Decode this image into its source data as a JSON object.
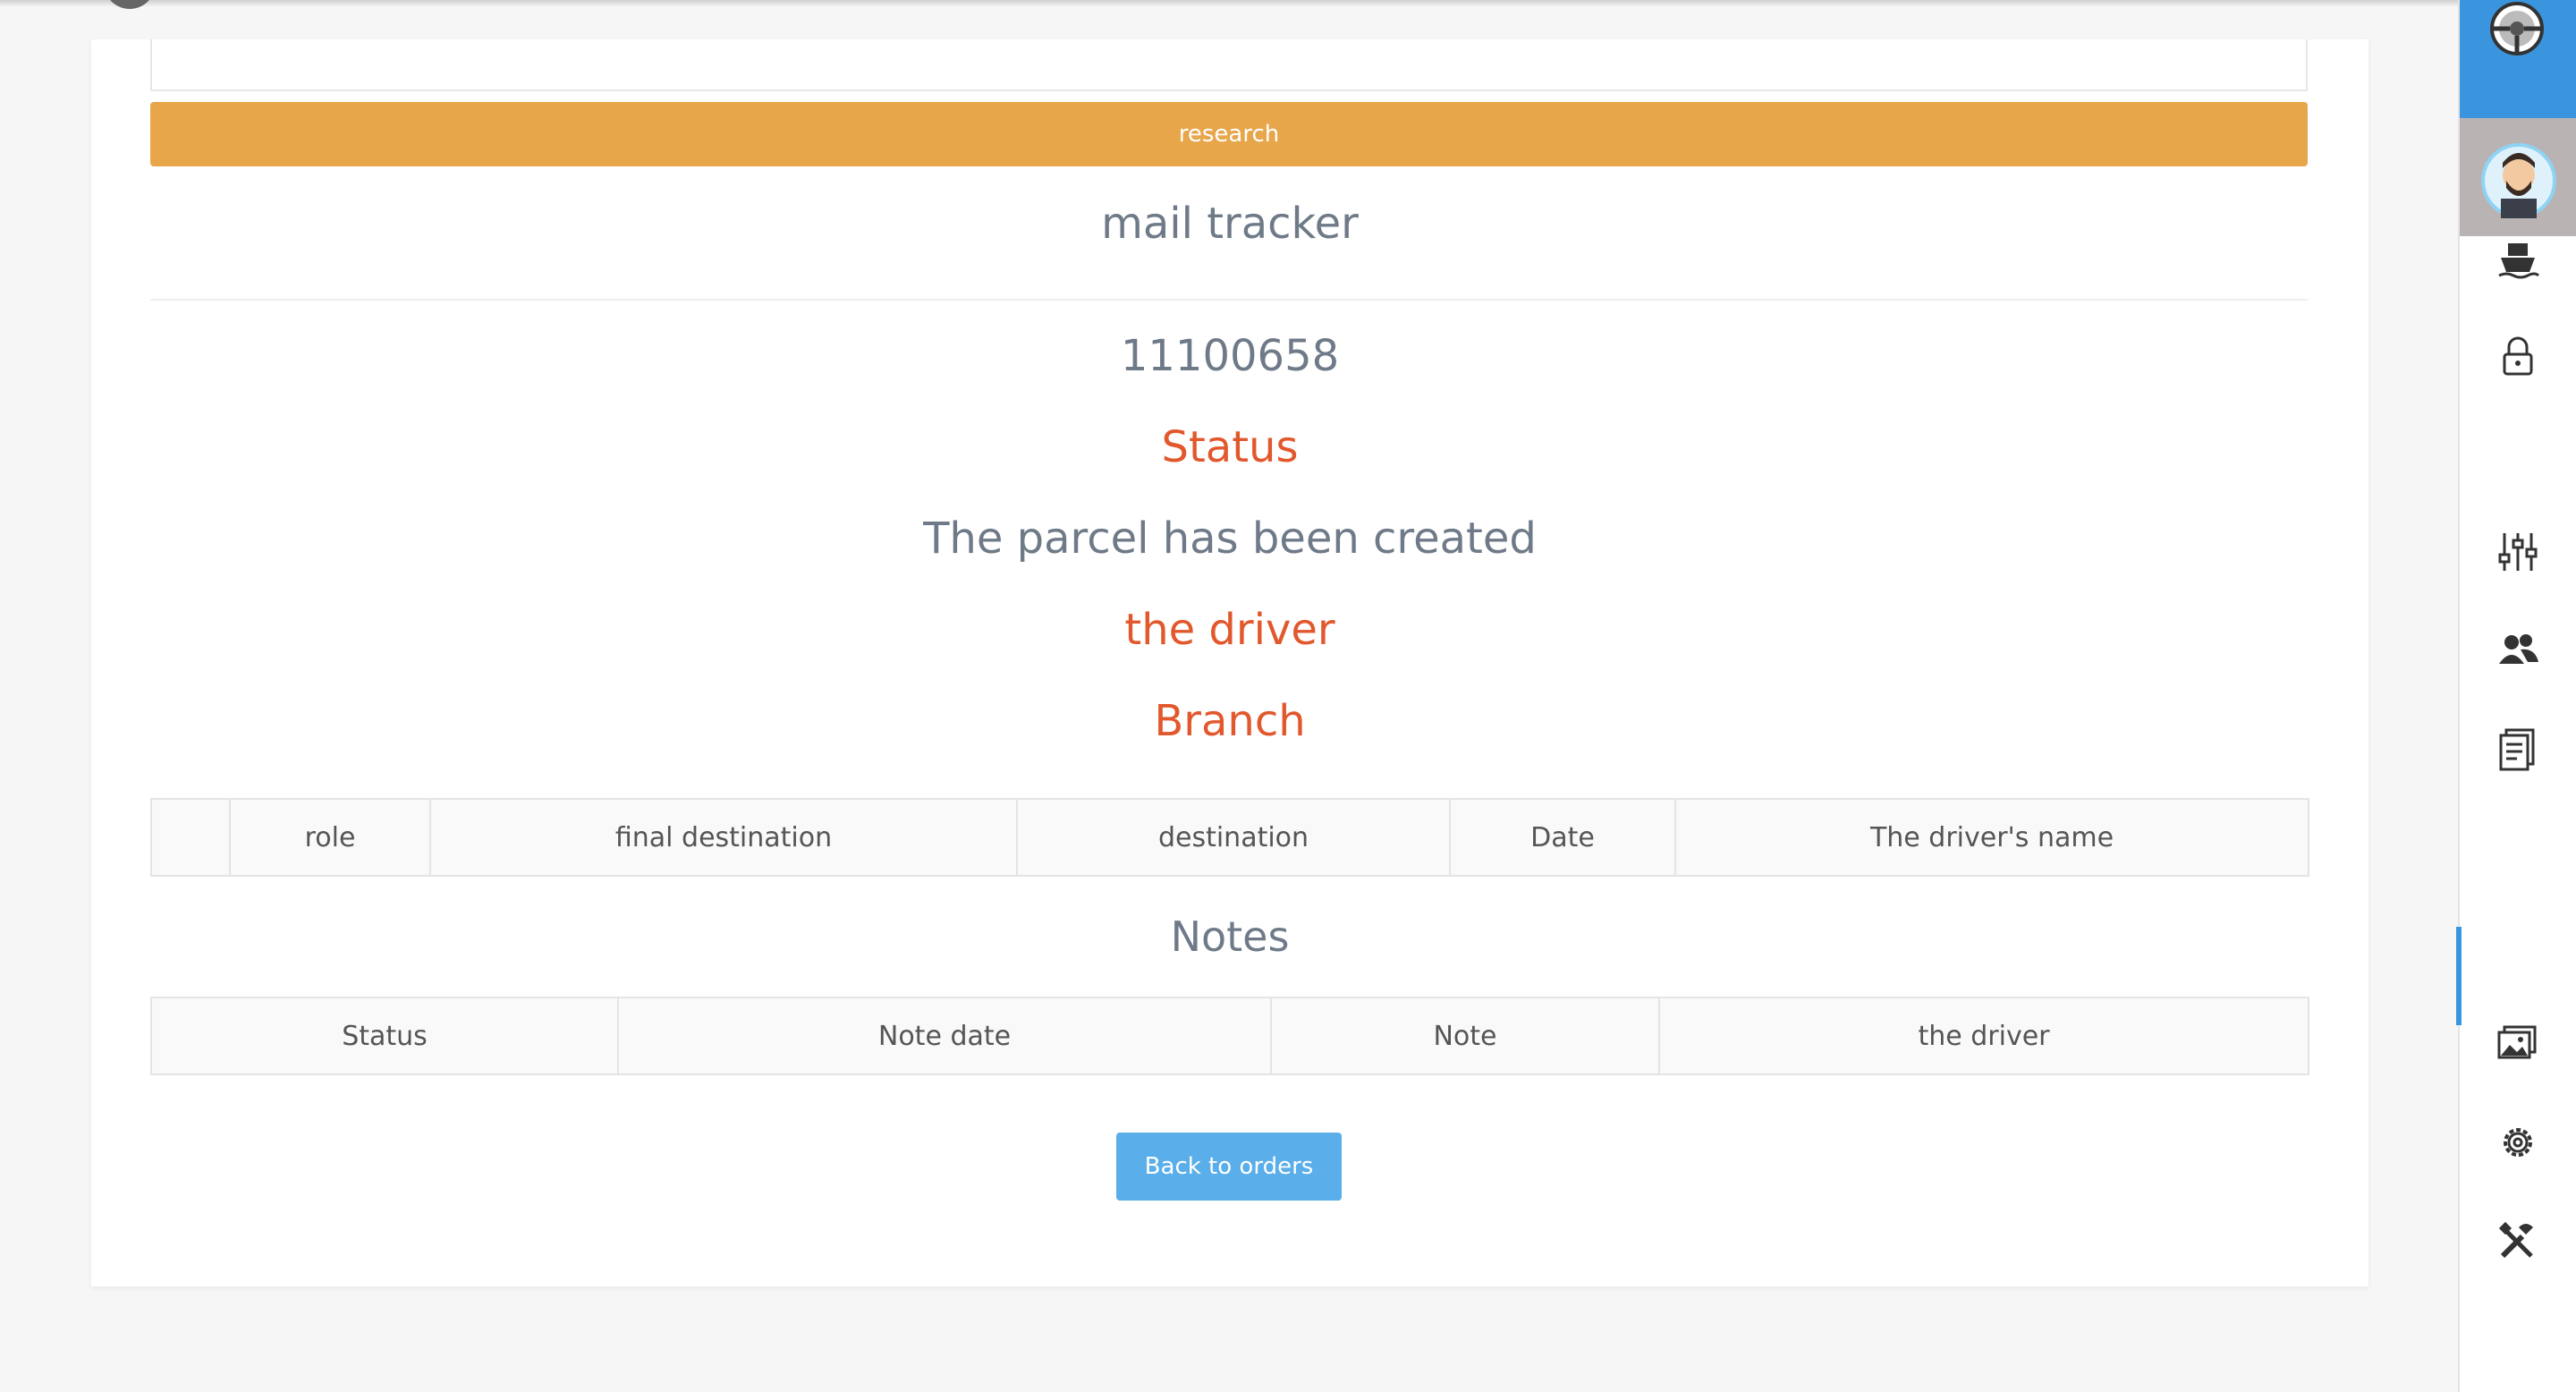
{
  "search": {
    "value": "",
    "button_label": "research"
  },
  "tracker": {
    "title": "mail tracker",
    "number": "11100658",
    "status_label": "Status",
    "status_value": "The parcel has been created",
    "driver_label": "the driver",
    "branch_label": "Branch"
  },
  "route_table": {
    "headers": [
      "",
      "role",
      "final destination",
      "destination",
      "Date",
      "The driver's name"
    ]
  },
  "notes": {
    "title": "Notes",
    "headers": [
      "Status",
      "Note date",
      "Note",
      "the driver"
    ]
  },
  "actions": {
    "back_label": "Back to orders"
  },
  "sidebar": {
    "icons": [
      "steering-wheel-icon",
      "avatar",
      "ship-icon",
      "lock-icon",
      "sliders-icon",
      "users-icon",
      "document-icon",
      "image-icon",
      "gear-icon",
      "tools-icon"
    ]
  },
  "colors": {
    "accent_orange": "#e8a64b",
    "label_red": "#e2582d",
    "button_blue": "#5aaee9",
    "sidebar_blue": "#3b95de"
  }
}
